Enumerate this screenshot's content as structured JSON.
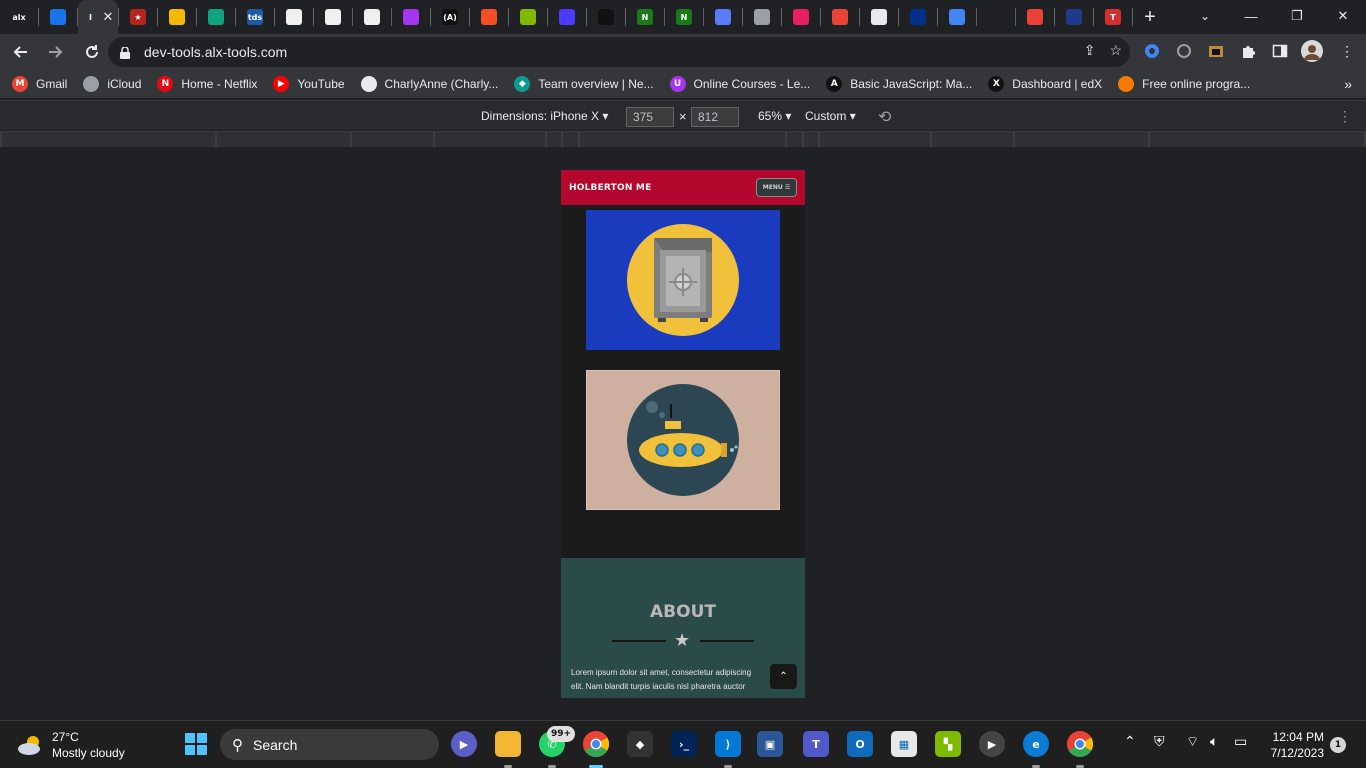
{
  "browser": {
    "tabs": [
      {
        "icon": "alx-icon",
        "label": "alx",
        "color": "#202124"
      },
      {
        "icon": "refresh-blue-icon",
        "label": "",
        "color": "#1a73e8"
      },
      {
        "icon": "active-tab",
        "label": "I",
        "color": "#35363a"
      },
      {
        "icon": "star-icon",
        "label": "★",
        "color": "#b3261e"
      },
      {
        "icon": "emoji-icon",
        "label": "",
        "color": "#f6b900"
      },
      {
        "icon": "chatgpt-icon",
        "label": "",
        "color": "#10a37f"
      },
      {
        "icon": "tds-icon",
        "label": "tds",
        "color": "#1e5aa8"
      },
      {
        "icon": "github-icon",
        "label": "",
        "color": "#f0f0f0"
      },
      {
        "icon": "github-icon",
        "label": "",
        "color": "#f0f0f0"
      },
      {
        "icon": "github-icon",
        "label": "",
        "color": "#f0f0f0"
      },
      {
        "icon": "udemy-icon",
        "label": "",
        "color": "#a435f0"
      },
      {
        "icon": "alx-a-icon",
        "label": "(A)",
        "color": "#111111"
      },
      {
        "icon": "microsoft-icon",
        "label": "",
        "color": "#f25022"
      },
      {
        "icon": "microsoft-icon",
        "label": "",
        "color": "#7fba00"
      },
      {
        "icon": "terminal-icon",
        "label": "",
        "color": "#4b3bff"
      },
      {
        "icon": "check-icon",
        "label": "",
        "color": "#111111"
      },
      {
        "icon": "notion-n-icon",
        "label": "N",
        "color": "#1a7a1a"
      },
      {
        "icon": "notion-n-icon",
        "label": "N",
        "color": "#1a7a1a"
      },
      {
        "icon": "app-icon",
        "label": "",
        "color": "#5b7cfa"
      },
      {
        "icon": "layers-icon",
        "label": "",
        "color": "#9aa0a6"
      },
      {
        "icon": "colorful-icon",
        "label": "",
        "color": "#e91e63"
      },
      {
        "icon": "gmail-icon",
        "label": "",
        "color": "#ea4335"
      },
      {
        "icon": "doc-icon",
        "label": "",
        "color": "#e8eaed"
      },
      {
        "icon": "paypal-icon",
        "label": "",
        "color": "#003087"
      },
      {
        "icon": "db-icon",
        "label": "",
        "color": "#4285f4"
      },
      {
        "icon": "blank-icon",
        "label": "",
        "color": "#202124"
      },
      {
        "icon": "pin-icon",
        "label": "",
        "color": "#ea4335"
      },
      {
        "icon": "s-icon",
        "label": "",
        "color": "#1e3a8a"
      },
      {
        "icon": "t-icon",
        "label": "T",
        "color": "#d32f2f"
      }
    ],
    "new_tab": "+",
    "tab_search": "⌄",
    "window": {
      "minimize": "—",
      "maximize": "❐",
      "close": "✕"
    },
    "url": "dev-tools.alx-tools.com",
    "bookmarks": [
      {
        "label": "Gmail",
        "icon_text": "M",
        "color": "#ea4335"
      },
      {
        "label": "iCloud",
        "icon_text": "",
        "color": "#9aa0a6"
      },
      {
        "label": "Home - Netflix",
        "icon_text": "N",
        "color": "#e50914"
      },
      {
        "label": "YouTube",
        "icon_text": "▶",
        "color": "#ff0000"
      },
      {
        "label": "CharlyAnne (Charly...",
        "icon_text": "",
        "color": "#e8eaed"
      },
      {
        "label": "Team overview | Ne...",
        "icon_text": "◆",
        "color": "#0a9d8f"
      },
      {
        "label": "Online Courses - Le...",
        "icon_text": "U",
        "color": "#a435f0"
      },
      {
        "label": "Basic JavaScript: Ma...",
        "icon_text": "A",
        "color": "#111111"
      },
      {
        "label": "Dashboard | edX",
        "icon_text": "X",
        "color": "#111111"
      },
      {
        "label": "Free online progra...",
        "icon_text": "",
        "color": "#f57c00"
      }
    ],
    "bookmarks_more": "»"
  },
  "device_toolbar": {
    "dimensions_label": "Dimensions: iPhone X",
    "width": "375",
    "height": "812",
    "times": "×",
    "zoom": "65%",
    "throttle": "Custom"
  },
  "page": {
    "brand": "HOLBERTON ME",
    "menu_label": "MENU ☰",
    "about_title": "ABOUT",
    "about_text_1": "Lorem ipsum dolor sit amet, consectetur adipiscing",
    "about_text_2": "elit. Nam blandit turpis iaculis nisl pharetra auctor",
    "back_to_top": "⌃",
    "colors": {
      "navbar": "#b3072e",
      "safe_card": "#1a3bbe",
      "sub_card": "#cdb0a0",
      "about_bg": "#2b4a4a"
    }
  },
  "taskbar": {
    "weather_temp": "27°C",
    "weather_desc": "Mostly cloudy",
    "search_label": "Search",
    "badge": "99+",
    "time": "12:04 PM",
    "date": "7/12/2023",
    "notifications": "1"
  }
}
